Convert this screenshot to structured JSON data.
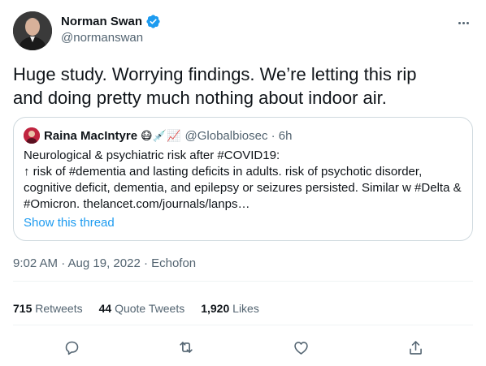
{
  "author": {
    "display_name": "Norman Swan",
    "handle": "@normanswan",
    "verified": true
  },
  "tweet": {
    "line1": "Huge study. Worrying findings. We’re letting this rip",
    "line2": "and doing pretty much nothing about indoor air."
  },
  "quote": {
    "display_name": "Raina MacIntyre",
    "emojis": "😷💉📈",
    "handle_time": "@Globalbiosec · 6h",
    "lines": [
      "Neurological & psychiatric risk after #COVID19:",
      "↑ risk of #dementia and lasting deficits in adults. risk of psychotic disorder,",
      "cognitive deficit, dementia, and epilepsy or seizures persisted. Similar w #Delta &",
      "#Omicron.  thelancet.com/journals/lanps…"
    ],
    "show_thread": "Show this thread"
  },
  "meta": {
    "time": "9:02 AM · Aug 19, 2022 · Echofon"
  },
  "stats": {
    "retweets_count": "715",
    "retweets_label": "Retweets",
    "quotes_count": "44",
    "quotes_label": "Quote Tweets",
    "likes_count": "1,920",
    "likes_label": "Likes"
  },
  "icons": {
    "verified": "verified-badge-icon",
    "more": "more-icon",
    "reply": "reply-icon",
    "retweet": "retweet-icon",
    "like": "like-icon",
    "share": "share-icon"
  },
  "colors": {
    "accent": "#1d9bf0",
    "secondary_text": "#536471",
    "border": "#cfd9de"
  }
}
